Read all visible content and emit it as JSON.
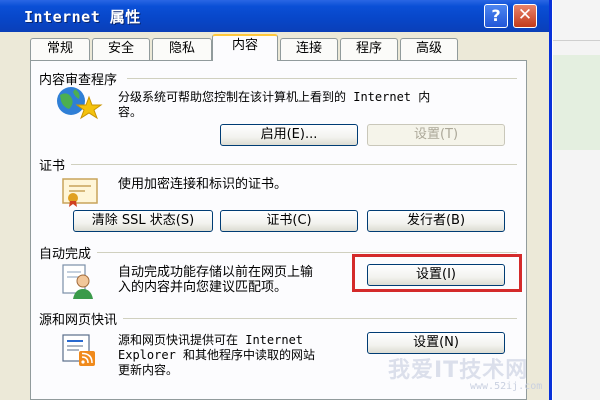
{
  "window": {
    "title": "Internet 属性",
    "help_glyph": "?",
    "close_glyph": "✕"
  },
  "tabs": [
    "常规",
    "安全",
    "隐私",
    "内容",
    "连接",
    "程序",
    "高级"
  ],
  "active_tab": "内容",
  "content_advisor": {
    "label": "内容审查程序",
    "description_line1": "分级系统可帮助您控制在该计算机上看到的 Internet 内",
    "description_line2": "容。",
    "enable_button": "启用(E)...",
    "settings_button": "设置(T)"
  },
  "certificates": {
    "label": "证书",
    "description": "使用加密连接和标识的证书。",
    "clear_ssl_button": "清除 SSL 状态(S)",
    "certificates_button": "证书(C)",
    "publishers_button": "发行者(B)"
  },
  "autocomplete": {
    "label": "自动完成",
    "description_line1": "自动完成功能存储以前在网页上输",
    "description_line2": "入的内容并向您建议匹配项。",
    "settings_button": "设置(I)"
  },
  "feeds": {
    "label": "源和网页快讯",
    "description_line1": "源和网页快讯提供可在 Internet",
    "description_line2": "Explorer 和其他程序中读取的网站",
    "description_line3": "更新内容。",
    "settings_button": "设置(N)"
  },
  "watermark": {
    "text": "我爱IT技术网",
    "url": "www.52ij.com"
  },
  "colors": {
    "title_bar": "#0846c8",
    "highlight": "#d42a2a",
    "face": "#ece9d8"
  }
}
